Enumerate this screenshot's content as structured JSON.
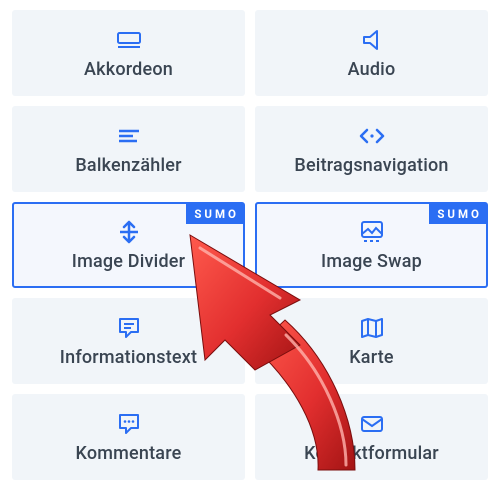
{
  "badge_label": "SUMO",
  "tiles": [
    {
      "id": "akkordeon",
      "label": "Akkordeon",
      "icon": "accordion-icon",
      "highlight": false,
      "badge": false
    },
    {
      "id": "audio",
      "label": "Audio",
      "icon": "speaker-icon",
      "highlight": false,
      "badge": false
    },
    {
      "id": "balkenzaehler",
      "label": "Balkenzähler",
      "icon": "bars-icon",
      "highlight": false,
      "badge": false
    },
    {
      "id": "beitragsnavigation",
      "label": "Beitragsnavigation",
      "icon": "code-nav-icon",
      "highlight": false,
      "badge": false
    },
    {
      "id": "image-divider",
      "label": "Image Divider",
      "icon": "divider-arrows-icon",
      "highlight": true,
      "badge": true
    },
    {
      "id": "image-swap",
      "label": "Image Swap",
      "icon": "image-swap-icon",
      "highlight": true,
      "badge": true
    },
    {
      "id": "informationstext",
      "label": "Informationstext",
      "icon": "info-text-icon",
      "highlight": false,
      "badge": false
    },
    {
      "id": "karte",
      "label": "Karte",
      "icon": "map-icon",
      "highlight": false,
      "badge": false
    },
    {
      "id": "kommentare",
      "label": "Kommentare",
      "icon": "comments-icon",
      "highlight": false,
      "badge": false
    },
    {
      "id": "kontaktformular",
      "label": "Kontaktformular",
      "icon": "mail-icon",
      "highlight": false,
      "badge": false
    }
  ],
  "arrow_color": "#e53131"
}
